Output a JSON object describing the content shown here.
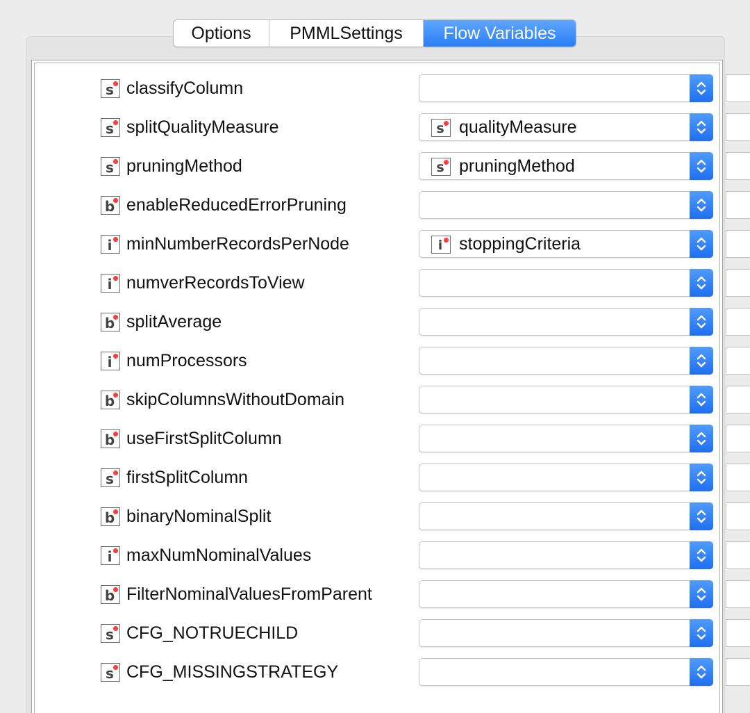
{
  "tabs": [
    {
      "label": "Options",
      "active": false
    },
    {
      "label": "PMMLSettings",
      "active": false
    },
    {
      "label": "Flow Variables",
      "active": true
    }
  ],
  "colors": {
    "accent": "#2a7df5",
    "dot": "#ff3b3b"
  },
  "rows": [
    {
      "type": "s",
      "name": "classifyColumn",
      "selected": "",
      "selected_type": ""
    },
    {
      "type": "s",
      "name": "splitQualityMeasure",
      "selected": "qualityMeasure",
      "selected_type": "s"
    },
    {
      "type": "s",
      "name": "pruningMethod",
      "selected": "pruningMethod",
      "selected_type": "s"
    },
    {
      "type": "b",
      "name": "enableReducedErrorPruning",
      "selected": "",
      "selected_type": ""
    },
    {
      "type": "i",
      "name": "minNumberRecordsPerNode",
      "selected": "stoppingCriteria",
      "selected_type": "i"
    },
    {
      "type": "i",
      "name": "numverRecordsToView",
      "selected": "",
      "selected_type": ""
    },
    {
      "type": "b",
      "name": "splitAverage",
      "selected": "",
      "selected_type": ""
    },
    {
      "type": "i",
      "name": "numProcessors",
      "selected": "",
      "selected_type": ""
    },
    {
      "type": "b",
      "name": "skipColumnsWithoutDomain",
      "selected": "",
      "selected_type": ""
    },
    {
      "type": "b",
      "name": "useFirstSplitColumn",
      "selected": "",
      "selected_type": ""
    },
    {
      "type": "s",
      "name": "firstSplitColumn",
      "selected": "",
      "selected_type": ""
    },
    {
      "type": "b",
      "name": "binaryNominalSplit",
      "selected": "",
      "selected_type": ""
    },
    {
      "type": "i",
      "name": "maxNumNominalValues",
      "selected": "",
      "selected_type": ""
    },
    {
      "type": "b",
      "name": "FilterNominalValuesFromParent",
      "selected": "",
      "selected_type": ""
    },
    {
      "type": "s",
      "name": "CFG_NOTRUECHILD",
      "selected": "",
      "selected_type": ""
    },
    {
      "type": "s",
      "name": "CFG_MISSINGSTRATEGY",
      "selected": "",
      "selected_type": ""
    }
  ]
}
